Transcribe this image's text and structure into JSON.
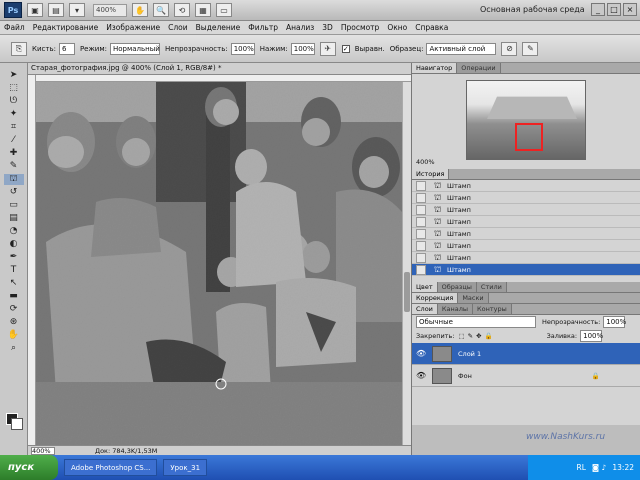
{
  "app": {
    "logo_text": "Ps",
    "zoom_display": "400%",
    "workspace": "Основная рабочая среда"
  },
  "menu": [
    "Файл",
    "Редактирование",
    "Изображение",
    "Слои",
    "Выделение",
    "Фильтр",
    "Анализ",
    "3D",
    "Просмотр",
    "Окно",
    "Справка"
  ],
  "options": {
    "brush_label": "Кисть:",
    "brush_size": "6",
    "mode_label": "Режим:",
    "mode_value": "Нормальный",
    "opacity_label": "Непрозрачность:",
    "opacity_value": "100%",
    "pressure_label": "Нажим:",
    "pressure_value": "100%",
    "align_label": "Выравн.",
    "sample_label": "Образец:",
    "sample_value": "Активный слой"
  },
  "document": {
    "tab_title": "Старая_фотография.jpg @ 400% (Слой 1, RGB/8#) *",
    "status_zoom": "400%",
    "status_doc": "Док: 784,3K/1,53M"
  },
  "navigator": {
    "tabs": [
      "Навигатор",
      "Операции"
    ],
    "zoom": "400%"
  },
  "history": {
    "title": "История",
    "items": [
      "Штамп",
      "Штамп",
      "Штамп",
      "Штамп",
      "Штамп",
      "Штамп",
      "Штамп",
      "Штамп"
    ]
  },
  "color_tabs": [
    "Цвет",
    "Образцы",
    "Стили"
  ],
  "adjust_tabs": [
    "Коррекция",
    "Маски"
  ],
  "layers": {
    "tabs": [
      "Слои",
      "Каналы",
      "Контуры"
    ],
    "blend_mode": "Обычные",
    "opacity_label": "Непрозрачность:",
    "opacity_value": "100%",
    "lock_label": "Закрепить:",
    "fill_label": "Заливка:",
    "fill_value": "100%",
    "items": [
      {
        "name": "Слой 1"
      },
      {
        "name": "Фон"
      }
    ]
  },
  "watermark": "www.NashKurs.ru",
  "taskbar": {
    "start": "пуск",
    "tasks": [
      "Adobe Photoshop CS...",
      "Урок_31"
    ],
    "lang": "RL",
    "time": "13:22"
  }
}
